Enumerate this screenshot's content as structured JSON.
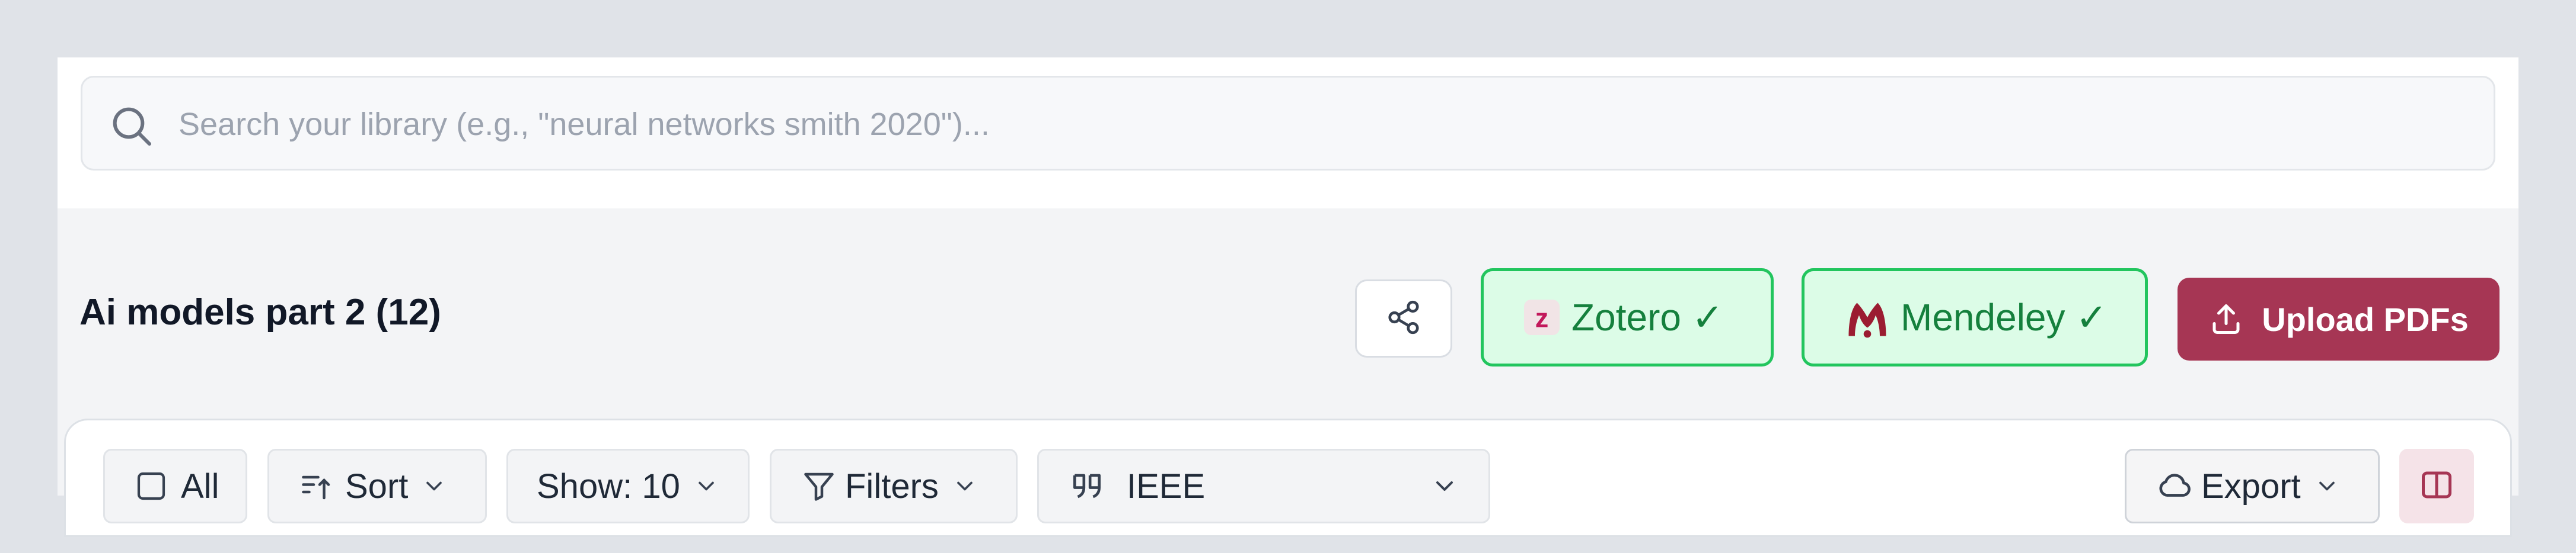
{
  "search": {
    "placeholder": "Search your library (e.g., \"neural networks smith 2020\")...",
    "icon": "search-icon"
  },
  "collection": {
    "title": "Ai models part 2 (12)"
  },
  "header_actions": {
    "share_icon": "share-icon",
    "zotero_label": "Zotero ✓",
    "mendeley_label": "Mendeley ✓",
    "upload_label": "Upload PDFs",
    "upload_icon": "upload-icon"
  },
  "toolbar": {
    "all_label": "All",
    "sort_label": "Sort",
    "show_label": "Show: 10",
    "filters_label": "Filters",
    "citation_style": "IEEE",
    "export_label": "Export"
  },
  "colors": {
    "sync_bg": "#dcfce7",
    "sync_border": "#22c55e",
    "sync_text": "#15803d",
    "upload_bg": "#a63654",
    "panel_toggle_bg": "#f5e3e8",
    "panel_toggle_icon": "#a63654"
  }
}
